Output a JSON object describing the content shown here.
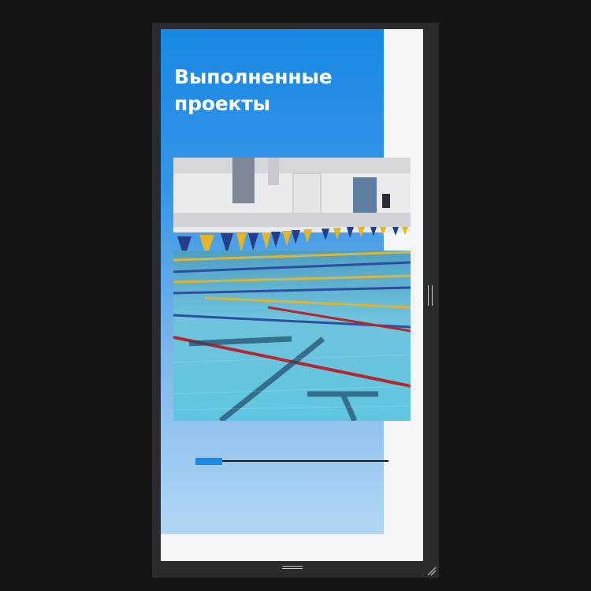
{
  "section": {
    "title": "Выполненные проекты"
  },
  "slider": {
    "position_fraction": 0.14
  },
  "colors": {
    "accent": "#1e88e5",
    "hero_top": "#1888e4",
    "hero_bottom": "#b2d7f5"
  },
  "icons": {
    "horizontal_resize": "grip-horizontal-icon",
    "vertical_resize": "grip-vertical-icon",
    "corner_resize": "resize-corner-icon"
  }
}
